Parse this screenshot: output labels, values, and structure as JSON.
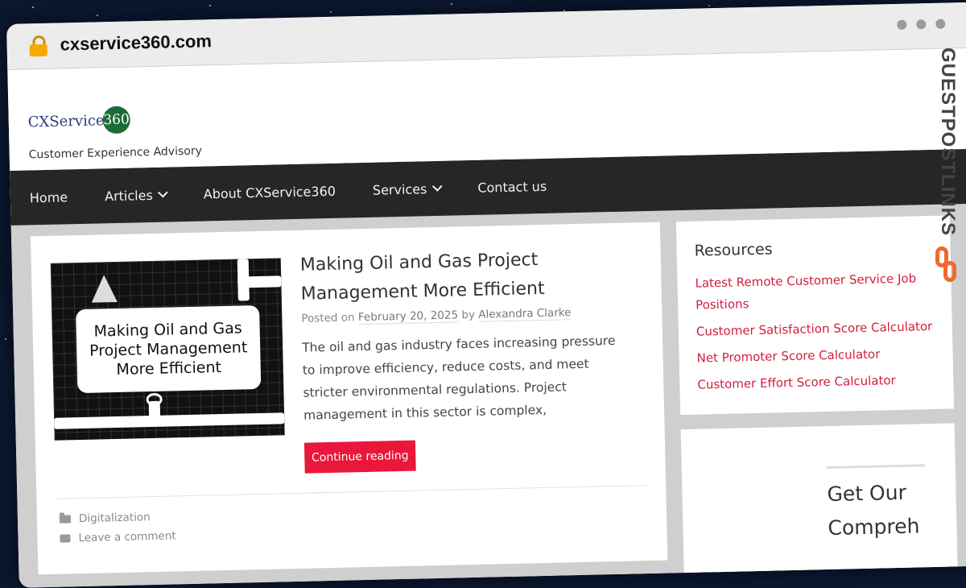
{
  "browser": {
    "url": "cxservice360.com"
  },
  "site": {
    "logo_text": "CXService",
    "logo_number": "360",
    "tagline": "Customer Experience Advisory"
  },
  "nav": {
    "items": [
      {
        "label": "Home"
      },
      {
        "label": "Articles"
      },
      {
        "label": "About CXService360"
      },
      {
        "label": "Services"
      },
      {
        "label": "Contact us"
      }
    ]
  },
  "article": {
    "image_text": "Making Oil and Gas Project Management More Efficient",
    "title": "Making Oil and Gas Project Management More Efficient",
    "posted_on": "Posted on",
    "date": "February 20, 2025",
    "by": "by",
    "author": "Alexandra Clarke",
    "excerpt": "The oil and gas industry faces increasing pressure to improve efficiency, reduce costs, and meet stricter environmental regulations. Project management in this sector is complex,",
    "continue_label": "Continue reading",
    "category": "Digitalization",
    "comment_label": "Leave a comment"
  },
  "sidebar": {
    "resources_title": "Resources",
    "resources_links": [
      {
        "label": "Latest Remote Customer Service Job Positions"
      },
      {
        "label": "Customer Satisfaction Score Calculator"
      },
      {
        "label": "Net Promoter Score Calculator"
      },
      {
        "label": "Customer Effort Score Calculator"
      }
    ],
    "promo_line1": "Get Our",
    "promo_line2": "Compreh"
  },
  "watermark": {
    "text": "GUESTPOSTLINKS"
  },
  "colors": {
    "accent": "#e8173b",
    "link": "#d21d3e",
    "nav_bg": "#262626",
    "logo_green": "#1d6b35"
  }
}
